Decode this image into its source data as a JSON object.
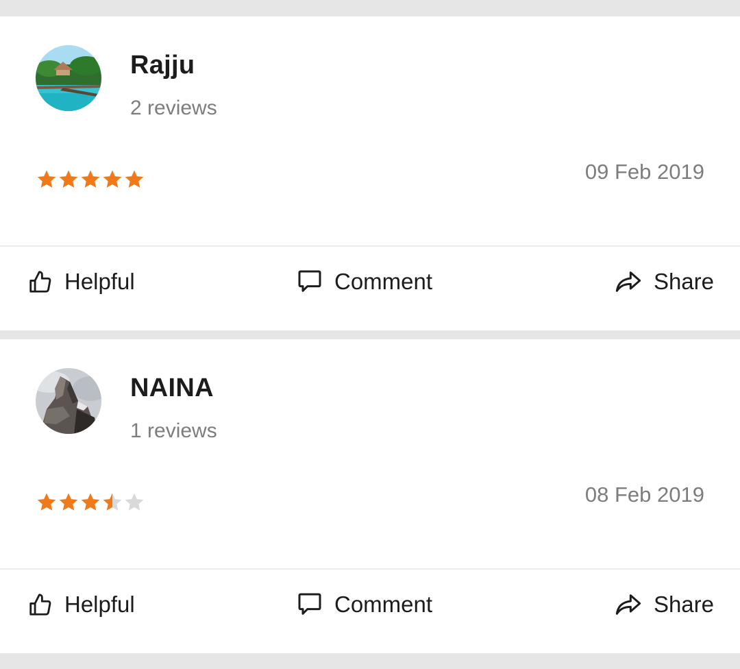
{
  "reviews": [
    {
      "name": "Rajju",
      "review_count": "2 reviews",
      "rating": 5,
      "rating_max": 5,
      "date": "09 Feb 2019",
      "avatar": "beach-resort-photo"
    },
    {
      "name": "NAINA",
      "review_count": "1 reviews",
      "rating": 3.5,
      "rating_max": 5,
      "date": "08 Feb 2019",
      "avatar": "mountain-peak-photo"
    }
  ],
  "actions": {
    "helpful_label": "Helpful",
    "comment_label": "Comment",
    "share_label": "Share"
  },
  "icons": {
    "helpful": "thumbs-up-icon",
    "comment": "comment-bubble-icon",
    "share": "share-arrow-icon"
  },
  "colors": {
    "star_filled": "#f0791a",
    "star_empty": "#d9d9d9",
    "text_primary": "#1c1c1c",
    "text_secondary": "#7d7d7d",
    "page_background": "#e6e6e6"
  }
}
